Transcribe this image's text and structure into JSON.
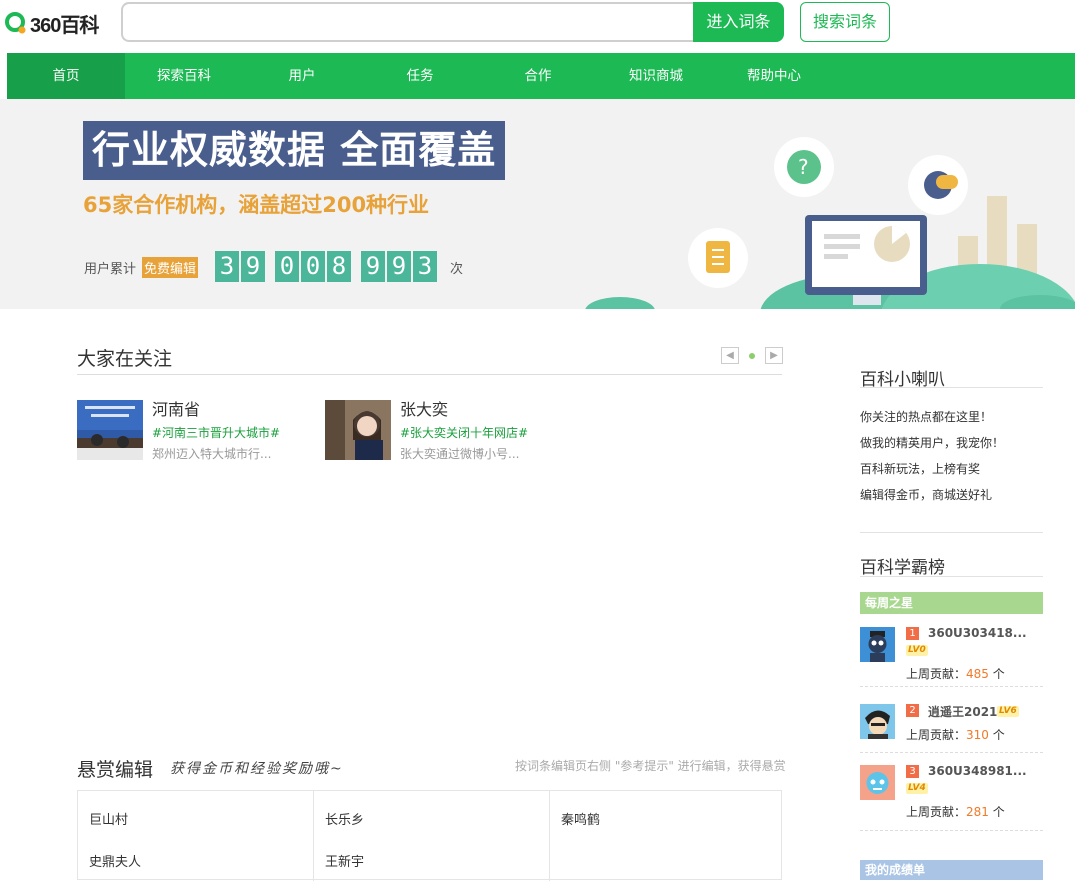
{
  "header": {
    "logo_text": "360百科",
    "search_placeholder": "",
    "enter_button": "进入词条",
    "search_button": "搜索词条"
  },
  "nav": {
    "items": [
      "首页",
      "探索百科",
      "用户",
      "任务",
      "合作",
      "知识商城",
      "帮助中心"
    ],
    "active": "首页"
  },
  "banner": {
    "headline": "行业权威数据 全面覆盖",
    "subtitle": "65家合作机构，涵盖超过200种行业",
    "counter_label": "用户累计",
    "counter_badge": "免费编辑",
    "digits": [
      "3",
      "9",
      "0",
      "0",
      "8",
      "9",
      "9",
      "3"
    ],
    "counter_unit": "次",
    "colors": {
      "headline_bg": "#4a5e8e",
      "accent": "#e8a23a",
      "digit_bg": "#4cb69b"
    }
  },
  "focus": {
    "title": "大家在关注",
    "prev_icon": "chevron-left-icon",
    "next_icon": "chevron-right-icon",
    "cards": [
      {
        "name": "河南省",
        "tag": "#河南三市晋升大城市#",
        "desc": "郑州迈入特大城市行..."
      },
      {
        "name": "张大奕",
        "tag": "#张大奕关闭十年网店#",
        "desc": "张大奕通过微博小号..."
      }
    ]
  },
  "reward": {
    "title": "悬赏编辑",
    "slogan": "获得金币和经验奖励哦~",
    "tip": "按词条编辑页右侧 \"参考提示\" 进行编辑，获得悬赏",
    "items": [
      "巨山村",
      "长乐乡",
      "秦鸣鹤",
      "史鼎夫人",
      "王新宇"
    ]
  },
  "sidebar": {
    "news_title": "百科小喇叭",
    "news": [
      "你关注的热点都在这里！",
      "做我的精英用户，我宠你！",
      "百科新玩法，上榜有奖",
      "编辑得金币，商城送好礼"
    ],
    "rank_title": "百科学霸榜",
    "weekly_label": "每周之星",
    "contrib_label": "上周贡献：",
    "contrib_unit": "个",
    "ranks": [
      {
        "num": "1",
        "user": "360U303418...",
        "level": "LV0",
        "value": "485"
      },
      {
        "num": "2",
        "user": "逍遥王2021",
        "level": "LV6",
        "value": "310"
      },
      {
        "num": "3",
        "user": "360U348981...",
        "level": "LV4",
        "value": "281"
      }
    ],
    "bottom_label": "我的成绩单",
    "colors": {
      "weekly_bar": "#a8d88f",
      "rank_num": "#f06d48",
      "value": "#f07a2a"
    }
  },
  "colors": {
    "brand": "#1db954",
    "nav_active": "#17a049"
  }
}
